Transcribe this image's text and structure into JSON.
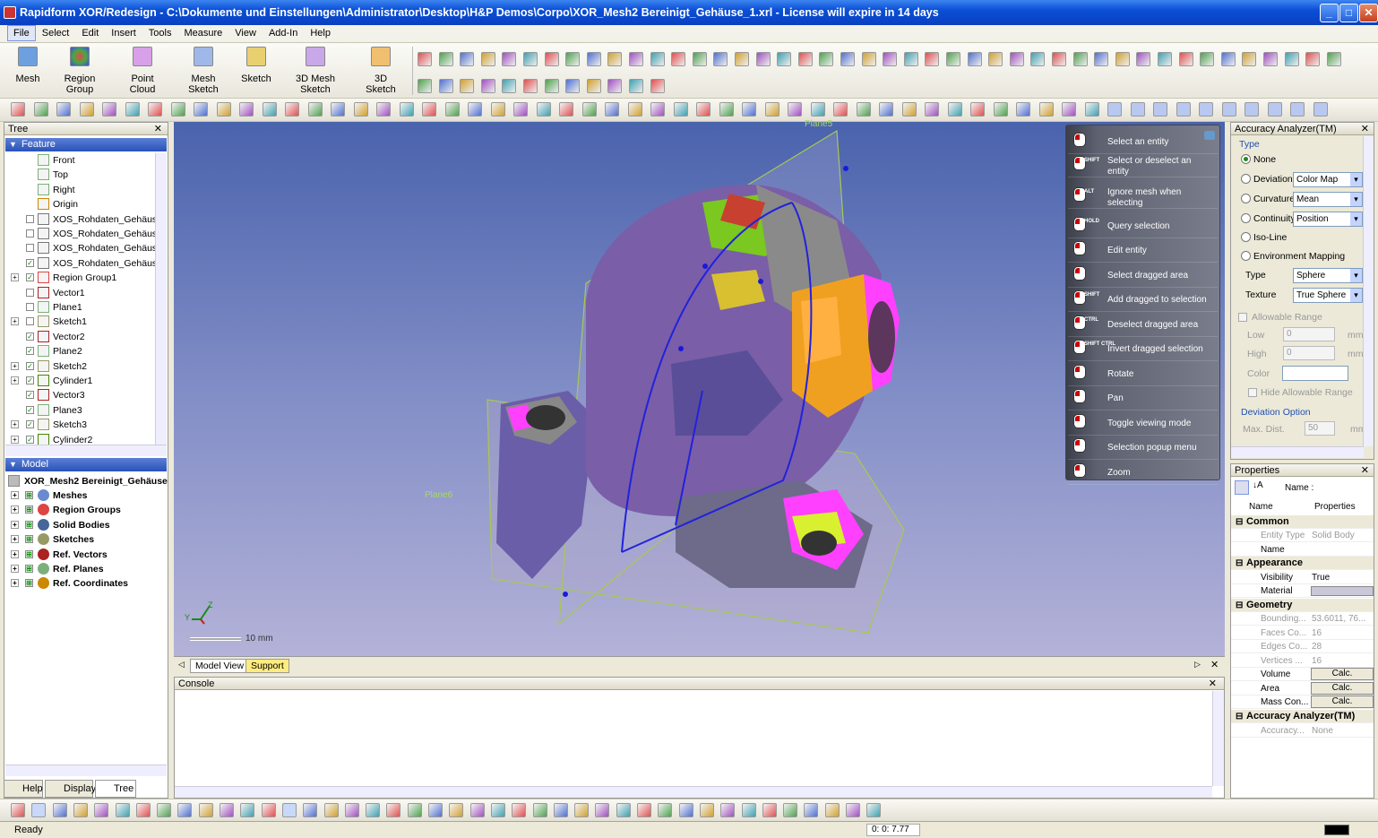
{
  "window": {
    "title": "Rapidform XOR/Redesign - C:\\Dokumente und Einstellungen\\Administrator\\Desktop\\H&P Demos\\Corpo\\XOR_Mesh2 Bereinigt_Gehäuse_1.xrl - License will expire in 14 days"
  },
  "menu": [
    "File",
    "Select",
    "Edit",
    "Insert",
    "Tools",
    "Measure",
    "View",
    "Add-In",
    "Help"
  ],
  "ribbon": {
    "buttons": [
      "Mesh",
      "Region Group",
      "Point Cloud",
      "Mesh Sketch",
      "Sketch",
      "3D Mesh Sketch",
      "3D Sketch"
    ]
  },
  "tree_panel": {
    "title": "Tree",
    "feature_header": "Feature",
    "feature_items": [
      {
        "label": "Front",
        "indent": 1,
        "checkbox": false,
        "expand": false,
        "checked": false
      },
      {
        "label": "Top",
        "indent": 1,
        "checkbox": false,
        "expand": false,
        "checked": false
      },
      {
        "label": "Right",
        "indent": 1,
        "checkbox": false,
        "expand": false,
        "checked": false
      },
      {
        "label": "Origin",
        "indent": 1,
        "checkbox": false,
        "expand": false,
        "checked": false
      },
      {
        "label": "XOS_Rohdaten_Gehäuse",
        "indent": 1,
        "checkbox": true,
        "expand": false,
        "checked": false
      },
      {
        "label": "XOS_Rohdaten_Gehäuse",
        "indent": 1,
        "checkbox": true,
        "expand": false,
        "checked": false
      },
      {
        "label": "XOS_Rohdaten_Gehäuse",
        "indent": 1,
        "checkbox": true,
        "expand": false,
        "checked": false
      },
      {
        "label": "XOS_Rohdaten_Gehäuse",
        "indent": 1,
        "checkbox": true,
        "expand": false,
        "checked": true
      },
      {
        "label": "Region Group1",
        "indent": 1,
        "checkbox": true,
        "expand": true,
        "checked": true
      },
      {
        "label": "Vector1",
        "indent": 1,
        "checkbox": true,
        "expand": false,
        "checked": false
      },
      {
        "label": "Plane1",
        "indent": 1,
        "checkbox": true,
        "expand": false,
        "checked": false
      },
      {
        "label": "Sketch1",
        "indent": 1,
        "checkbox": true,
        "expand": true,
        "checked": false
      },
      {
        "label": "Vector2",
        "indent": 1,
        "checkbox": true,
        "expand": false,
        "checked": true
      },
      {
        "label": "Plane2",
        "indent": 1,
        "checkbox": true,
        "expand": false,
        "checked": true
      },
      {
        "label": "Sketch2",
        "indent": 1,
        "checkbox": true,
        "expand": true,
        "checked": true
      },
      {
        "label": "Cylinder1",
        "indent": 1,
        "checkbox": true,
        "expand": true,
        "checked": true
      },
      {
        "label": "Vector3",
        "indent": 1,
        "checkbox": true,
        "expand": false,
        "checked": true
      },
      {
        "label": "Plane3",
        "indent": 1,
        "checkbox": true,
        "expand": false,
        "checked": true
      },
      {
        "label": "Sketch3",
        "indent": 1,
        "checkbox": true,
        "expand": true,
        "checked": true
      },
      {
        "label": "Cylinder2",
        "indent": 1,
        "checkbox": true,
        "expand": true,
        "checked": true
      }
    ],
    "model_header": "Model",
    "model_root": "XOR_Mesh2 Bereinigt_Gehäuse",
    "model_items": [
      "Meshes",
      "Region Groups",
      "Solid Bodies",
      "Sketches",
      "Ref. Vectors",
      "Ref. Planes",
      "Ref. Coordinates"
    ],
    "bottom_tabs": [
      "Help",
      "Display",
      "Tree"
    ]
  },
  "viewport": {
    "plane_labels": [
      "Plane5",
      "Plane6"
    ],
    "axis_labels": [
      "Y",
      "Z"
    ],
    "scale_label": "10 mm",
    "tabs": [
      "Model View",
      "Support"
    ]
  },
  "popup_menu": [
    {
      "label": "Select an entity",
      "mod": ""
    },
    {
      "label": "Select or deselect an entity",
      "mod": "SHIFT"
    },
    {
      "label": "Ignore mesh when selecting",
      "mod": "ALT"
    },
    {
      "label": "Query selection",
      "mod": "HOLD"
    },
    {
      "label": "Edit entity",
      "mod": ""
    },
    {
      "label": "Select dragged area",
      "mod": ""
    },
    {
      "label": "Add dragged to selection",
      "mod": "SHIFT"
    },
    {
      "label": "Deselect dragged area",
      "mod": "CTRL"
    },
    {
      "label": "Invert dragged selection",
      "mod": "SHIFT CTRL"
    },
    {
      "label": "Rotate",
      "mod": ""
    },
    {
      "label": "Pan",
      "mod": ""
    },
    {
      "label": "Toggle viewing mode",
      "mod": ""
    },
    {
      "label": "Selection popup menu",
      "mod": ""
    },
    {
      "label": "Zoom",
      "mod": ""
    }
  ],
  "console": {
    "title": "Console"
  },
  "accuracy": {
    "title": "Accuracy Analyzer(TM)",
    "type_label": "Type",
    "options": [
      "None",
      "Deviation",
      "Curvature",
      "Continuity",
      "Iso-Line",
      "Environment Mapping"
    ],
    "deviation_combo": "Color Map",
    "curvature_combo": "Mean",
    "continuity_combo": "Position",
    "type_field_label": "Type",
    "type_value": "Sphere",
    "texture_label": "Texture",
    "texture_value": "True Sphere",
    "allowable_range": "Allowable Range",
    "low_label": "Low",
    "high_label": "High",
    "low_value": "0",
    "high_value": "0",
    "unit": "mm",
    "color_label": "Color",
    "hide_allowable": "Hide Allowable Range",
    "deviation_option": "Deviation Option",
    "max_dist_label": "Max. Dist.",
    "max_dist_value": "50",
    "max_dist_unit": "mm"
  },
  "properties": {
    "title": "Properties",
    "name_label": "Name :",
    "col_name": "Name",
    "col_props": "Properties",
    "common": "Common",
    "entity_type_k": "Entity Type",
    "entity_type_v": "Solid Body",
    "name_k": "Name",
    "appearance": "Appearance",
    "visibility_k": "Visibility",
    "visibility_v": "True",
    "material_k": "Material",
    "geometry": "Geometry",
    "bounding_k": "Bounding...",
    "bounding_v": "53.6011, 76...",
    "faces_k": "Faces Co...",
    "faces_v": "16",
    "edges_k": "Edges Co...",
    "edges_v": "28",
    "vertices_k": "Vertices ...",
    "vertices_v": "16",
    "volume_k": "Volume",
    "area_k": "Area",
    "mass_k": "Mass Con...",
    "calc": "Calc.",
    "acc_cat": "Accuracy Analyzer(TM)",
    "accuracy_k": "Accuracy...",
    "accuracy_v": "None"
  },
  "status": {
    "text": "Ready",
    "coords": "0: 0: 7.77"
  }
}
